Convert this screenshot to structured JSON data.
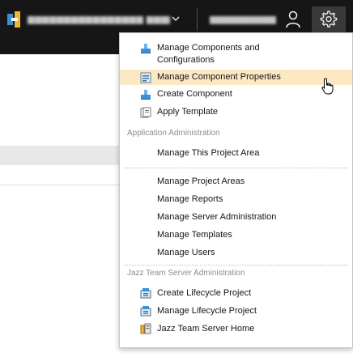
{
  "topbar": {
    "project_name": "▆▆▆▆▆▆▆▆▆▆▆▆▆▆▆▆ ▆▆▆▆▆",
    "user_name": "▆▆▆▆▆▆▆▆▆▆",
    "icons": {
      "logo": "application-logo",
      "project_chevron": "chevron-down-icon",
      "user": "user-icon",
      "settings": "gear-icon"
    }
  },
  "menu": {
    "items": [
      {
        "label_line1": "Manage Components and",
        "label_line2": "Configurations",
        "icon": "component-icon"
      },
      {
        "label": "Manage Component Properties",
        "icon": "properties-icon",
        "highlighted": true
      },
      {
        "label": "Create Component",
        "icon": "component-icon"
      },
      {
        "label": "Apply Template",
        "icon": "template-icon"
      }
    ],
    "app_admin": {
      "heading": "Application Administration",
      "items": [
        {
          "label": "Manage This Project Area"
        },
        {
          "label": "Manage Project Areas"
        },
        {
          "label": "Manage Reports"
        },
        {
          "label": "Manage Server Administration"
        },
        {
          "label": "Manage Templates"
        },
        {
          "label": "Manage Users"
        }
      ]
    },
    "jts_admin": {
      "heading": "Jazz Team Server Administration",
      "items": [
        {
          "label": "Create Lifecycle Project",
          "icon": "lifecycle-project-icon"
        },
        {
          "label": "Manage Lifecycle Project",
          "icon": "lifecycle-project-icon"
        },
        {
          "label": "Jazz Team Server Home",
          "icon": "server-home-icon"
        }
      ]
    }
  },
  "colors": {
    "topbar_bg": "#161616",
    "gear_active_bg": "#393939",
    "highlight": "#fde8c4"
  }
}
